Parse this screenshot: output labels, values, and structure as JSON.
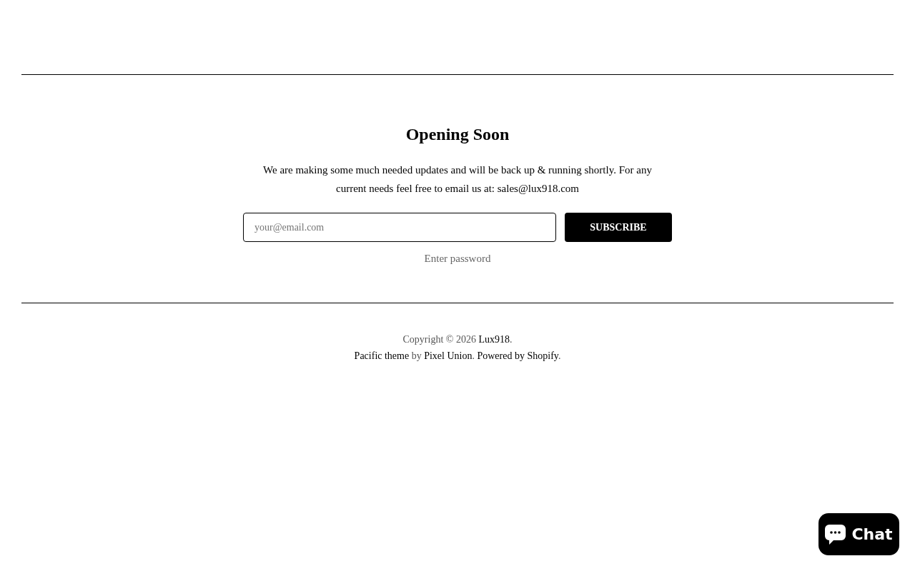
{
  "main": {
    "title": "Opening Soon",
    "message": "We are making some much needed updates and will be back up & running shortly. For any current needs feel free to email us at: sales@lux918.com",
    "email_field": {
      "placeholder": "your@email.com"
    },
    "subscribe_button": {
      "label": "SUBSCRIBE"
    },
    "password_link": {
      "label": "Enter password"
    }
  },
  "footer": {
    "lines": [
      {
        "segments": [
          {
            "kind": "text",
            "text": "Copyright © 2026 "
          },
          {
            "kind": "link",
            "text": "Lux918"
          },
          {
            "kind": "text",
            "text": "."
          }
        ]
      },
      {
        "segments": [
          {
            "kind": "link",
            "text": "Pacific theme"
          },
          {
            "kind": "text",
            "text": " by "
          },
          {
            "kind": "link",
            "text": "Pixel Union"
          },
          {
            "kind": "text",
            "text": ". "
          },
          {
            "kind": "link",
            "text": "Powered by Shopify"
          },
          {
            "kind": "text",
            "text": "."
          }
        ]
      }
    ]
  },
  "chat_button": {
    "label": "Chat"
  }
}
